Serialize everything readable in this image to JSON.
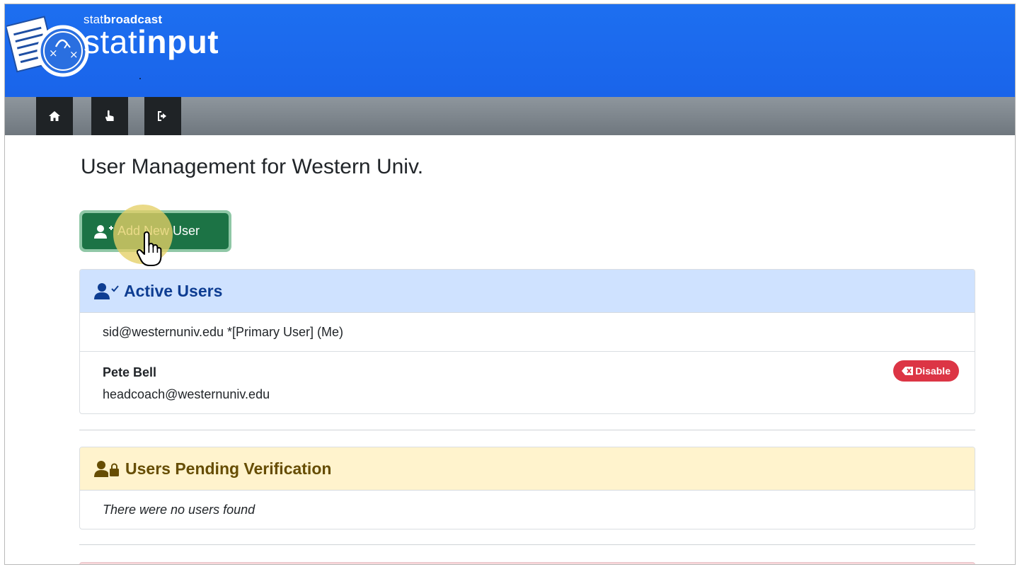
{
  "header": {
    "brand_small_prefix": "stat",
    "brand_small_bold": "broadcast",
    "brand_big_prefix": "stat",
    "brand_big_bold": "input"
  },
  "navbar": {
    "items": [
      {
        "icon": "home-icon"
      },
      {
        "icon": "pointer-hand-icon"
      },
      {
        "icon": "sign-out-icon"
      }
    ]
  },
  "main": {
    "title": "User Management for Western Univ.",
    "add_button_label": "Add New User"
  },
  "active_users": {
    "heading": "Active Users",
    "users": [
      {
        "line": "sid@westernuniv.edu *[Primary User] (Me)"
      },
      {
        "name": "Pete Bell",
        "email": "headcoach@westernuniv.edu",
        "action_label": "Disable"
      }
    ]
  },
  "pending_users": {
    "heading": "Users Pending Verification",
    "empty_message": "There were no users found"
  },
  "colors": {
    "banner": "#1a64ea",
    "add_button": "#1c7345",
    "active_header_bg": "#cfe2ff",
    "pending_header_bg": "#fff3cd",
    "disable_pill": "#dc3545"
  }
}
